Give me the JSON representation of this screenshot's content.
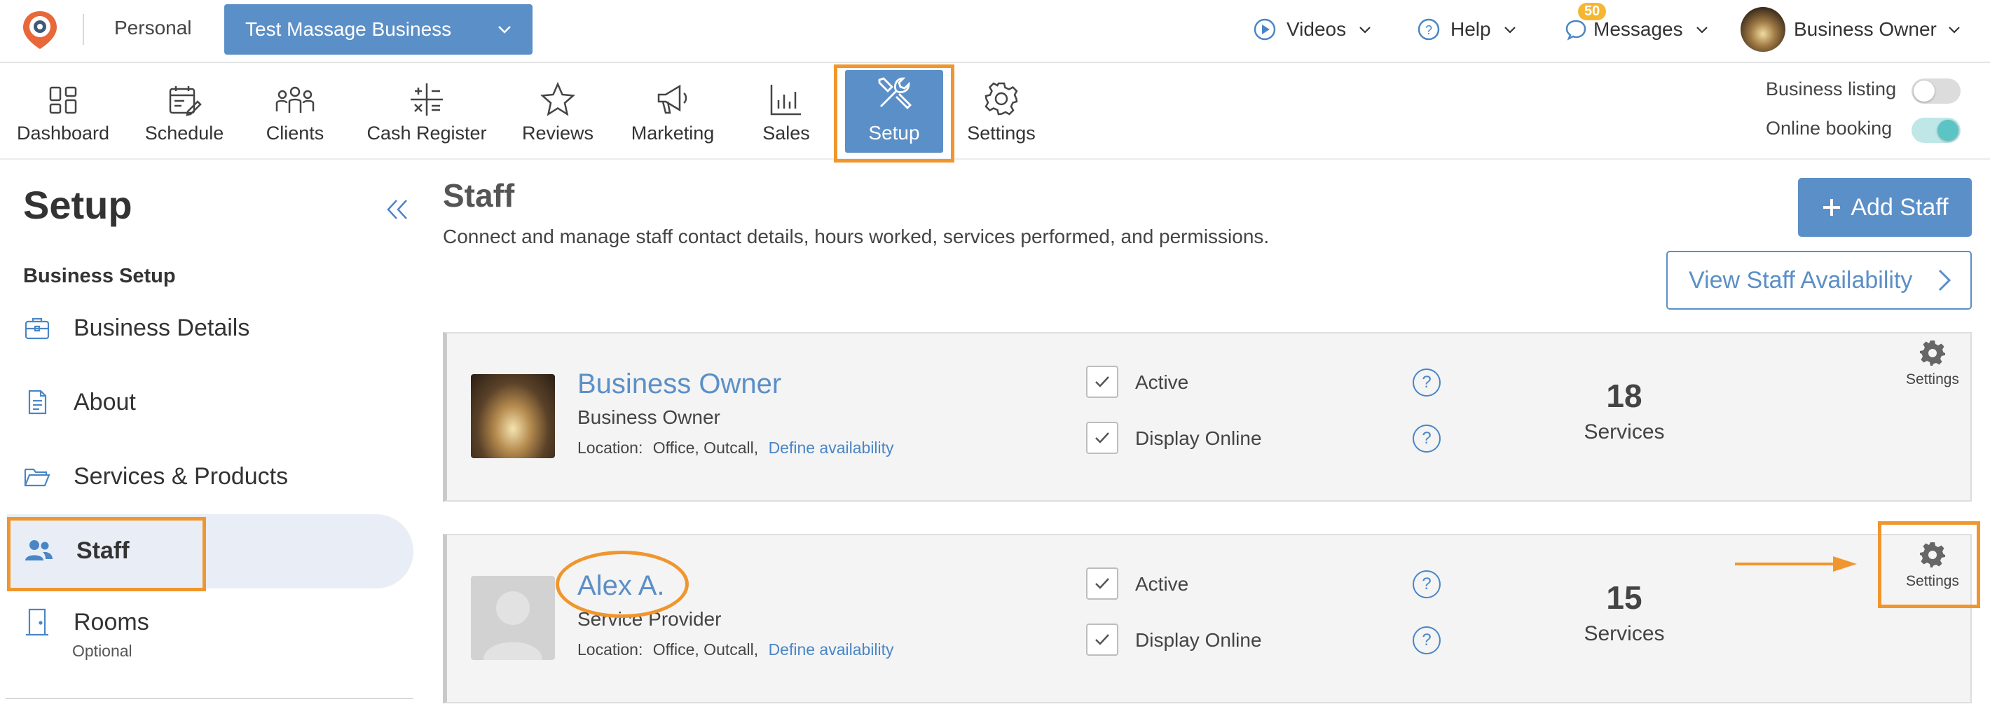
{
  "topbar": {
    "personal": "Personal",
    "business_select": "Test Massage Business",
    "videos": "Videos",
    "help": "Help",
    "messages": "Messages",
    "messages_badge": "50",
    "user": "Business Owner"
  },
  "nav": {
    "dashboard": "Dashboard",
    "schedule": "Schedule",
    "clients": "Clients",
    "cash_register": "Cash Register",
    "reviews": "Reviews",
    "marketing": "Marketing",
    "sales": "Sales",
    "setup": "Setup",
    "settings": "Settings",
    "business_listing": "Business listing",
    "business_listing_on": false,
    "online_booking": "Online booking",
    "online_booking_on": true
  },
  "sidebar": {
    "title": "Setup",
    "section": "Business Setup",
    "items": [
      {
        "label": "Business Details",
        "icon": "briefcase-icon"
      },
      {
        "label": "About",
        "icon": "document-icon"
      },
      {
        "label": "Services & Products",
        "icon": "folder-icon"
      },
      {
        "label": "Staff",
        "icon": "users-icon"
      },
      {
        "label": "Rooms",
        "icon": "door-icon",
        "sub": "Optional"
      }
    ]
  },
  "main": {
    "title": "Staff",
    "description": "Connect and manage staff contact details, hours worked, services performed, and permissions.",
    "add_staff": "Add Staff",
    "view_availability": "View Staff Availability",
    "staff": [
      {
        "name": "Business Owner",
        "role": "Business Owner",
        "location_label": "Location:",
        "locations": "Office,  Outcall,",
        "define_link": "Define availability",
        "active_label": "Active",
        "display_online_label": "Display Online",
        "services_count": "18",
        "services_label": "Services",
        "settings_label": "Settings"
      },
      {
        "name": "Alex A.",
        "role": "Service Provider",
        "location_label": "Location:",
        "locations": "Office,  Outcall,",
        "define_link": "Define availability",
        "active_label": "Active",
        "display_online_label": "Display Online",
        "services_count": "15",
        "services_label": "Services",
        "settings_label": "Settings"
      }
    ]
  },
  "colors": {
    "primary": "#5b8fc7",
    "highlight": "#f0962e",
    "toggle_on": "#5cc4c4"
  }
}
